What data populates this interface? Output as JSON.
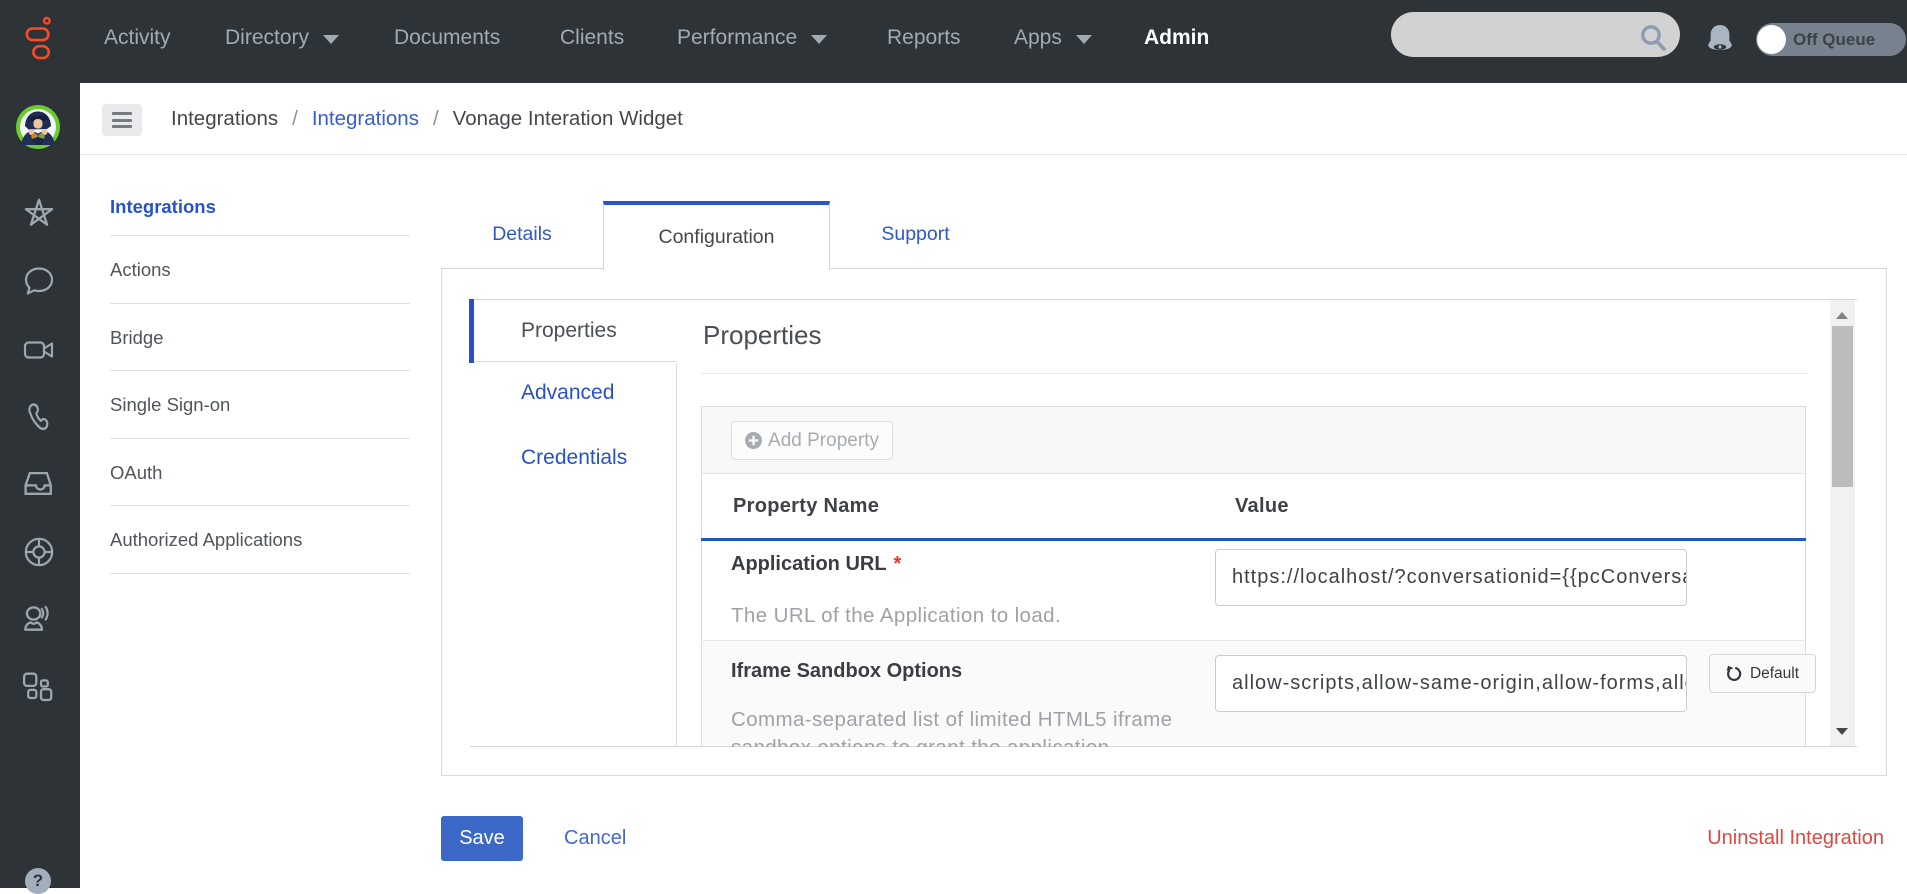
{
  "topnav": {
    "items": [
      {
        "label": "Activity",
        "caret": false
      },
      {
        "label": "Directory",
        "caret": true
      },
      {
        "label": "Documents",
        "caret": false
      },
      {
        "label": "Clients",
        "caret": false
      },
      {
        "label": "Performance",
        "caret": true
      },
      {
        "label": "Reports",
        "caret": false
      },
      {
        "label": "Apps",
        "caret": true
      },
      {
        "label": "Admin",
        "caret": false,
        "active": true
      }
    ],
    "search": {
      "value": "",
      "placeholder": ""
    },
    "off_queue_label": "Off Queue"
  },
  "sidebar": {
    "icons": [
      "star",
      "chat",
      "video",
      "phone",
      "inbox",
      "lifebuoy",
      "agent",
      "apps-grid"
    ],
    "help_label": "?"
  },
  "breadcrumb": {
    "separator": "/",
    "segments": [
      {
        "label": "Integrations",
        "link": false
      },
      {
        "label": "Integrations",
        "link": true
      },
      {
        "label": "Vonage Interation Widget",
        "link": false
      }
    ]
  },
  "leftnav": {
    "heading": "Integrations",
    "items": [
      "Actions",
      "Bridge",
      "Single Sign-on",
      "OAuth",
      "Authorized Applications"
    ]
  },
  "tabs": {
    "items": [
      "Details",
      "Configuration",
      "Support"
    ],
    "active": "Configuration"
  },
  "subtabs": {
    "items": [
      "Properties",
      "Advanced",
      "Credentials"
    ],
    "active": "Properties"
  },
  "panel": {
    "heading": "Properties",
    "add_button": "Add Property",
    "table": {
      "col1": "Property Name",
      "col2": "Value",
      "rows": [
        {
          "name": "Application URL",
          "required": "*",
          "desc_line1": "The URL of the Application to load.",
          "value": "https://localhost/?conversationid={{pcConversationId}}"
        },
        {
          "name": "Iframe Sandbox Options",
          "desc_line1": "Comma-separated list of limited HTML5 iframe",
          "desc_line2": "sandbox options to grant the application.",
          "value": "allow-scripts,allow-same-origin,allow-forms,allow-modals,allow-popups,allow-presentation,allow-downloads",
          "default_button": "Default"
        }
      ]
    }
  },
  "footer": {
    "save": "Save",
    "cancel": "Cancel",
    "uninstall": "Uninstall Integration"
  },
  "colors": {
    "topbar": "#2E3338",
    "brand_orange": "#FA4B22",
    "accent_blue": "#2A50C8",
    "avatar_ring_green": "#69CE2C",
    "danger_red": "#DE4840",
    "save_blue": "#3C68C8"
  }
}
